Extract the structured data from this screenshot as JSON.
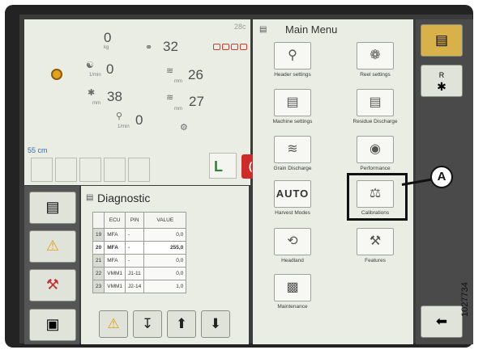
{
  "dashboard": {
    "temperature": "28c",
    "weight_value": "0",
    "weight_unit": "kg",
    "speed_value": "32",
    "rpm_left_value": "0",
    "rpm_left_unit": "1/min",
    "left_mid_value": "38",
    "left_mid_unit": "mm",
    "left_low_value": "0",
    "left_low_unit": "1/min",
    "right_top_value": "26",
    "right_top_unit": "mm",
    "right_mid_value": "27",
    "right_mid_unit": "mm",
    "height_label": "55 cm",
    "gear_label": "L",
    "park_label": "(P)"
  },
  "diagnostic": {
    "title": "Diagnostic",
    "columns": [
      "ECU",
      "PIN",
      "VALUE"
    ],
    "rows": [
      {
        "idx": "19",
        "ecu": "MFA",
        "pin": "-",
        "value": "0,0"
      },
      {
        "idx": "20",
        "ecu": "MFA",
        "pin": "-",
        "value": "255,0"
      },
      {
        "idx": "21",
        "ecu": "MFA",
        "pin": "-",
        "value": "0,0"
      },
      {
        "idx": "22",
        "ecu": "VMM1",
        "pin": "J1-11",
        "value": "0,0"
      },
      {
        "idx": "23",
        "ecu": "VMM1",
        "pin": "J2-14",
        "value": "1,0"
      }
    ]
  },
  "main_menu": {
    "title": "Main Menu",
    "items": [
      {
        "label": "Header settings",
        "icon": "header-settings-icon"
      },
      {
        "label": "Reel settings",
        "icon": "reel-settings-icon"
      },
      {
        "label": "Machine settings",
        "icon": "machine-settings-icon"
      },
      {
        "label": "Residue Discharge",
        "icon": "residue-discharge-icon"
      },
      {
        "label": "Grain Discharge",
        "icon": "grain-discharge-icon"
      },
      {
        "label": "Performance",
        "icon": "performance-icon"
      },
      {
        "label": "Harvest Modes",
        "icon": "harvest-modes-icon",
        "tile_text": "AUTO"
      },
      {
        "label": "Calibrations",
        "icon": "calibrations-icon"
      },
      {
        "label": "Headland",
        "icon": "headland-icon"
      },
      {
        "label": "Features",
        "icon": "features-icon"
      },
      {
        "label": "Maintenance",
        "icon": "maintenance-icon"
      }
    ]
  },
  "right_bar": {
    "r_label": "R"
  },
  "callout": {
    "label": "A"
  },
  "figure_id": "1027734",
  "colors": {
    "panel": "#e9ede4",
    "bezel": "#232323",
    "accent_yellow": "#d9b14a",
    "park_red": "#cf2a2a",
    "gear_green": "#2a8a2a"
  }
}
